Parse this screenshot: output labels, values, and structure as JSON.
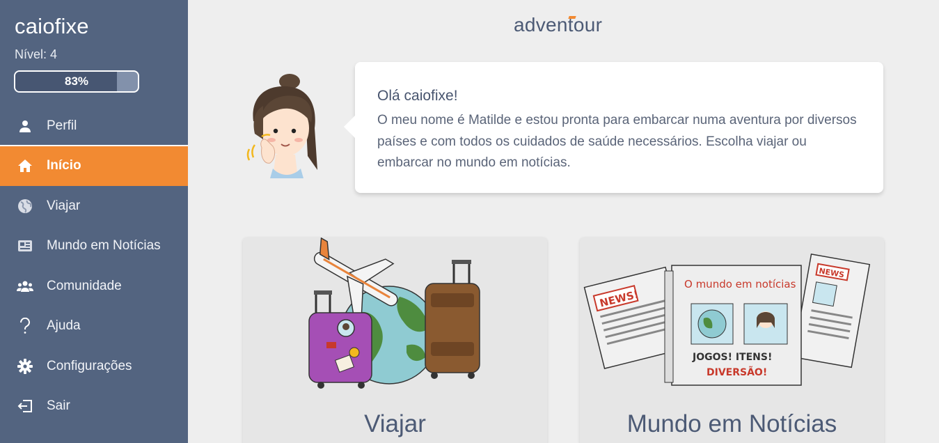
{
  "user": {
    "name": "caiofixe",
    "level_label": "Nível: 4",
    "progress_percent": 83,
    "progress_label": "83%"
  },
  "nav": [
    {
      "label": "Perfil",
      "icon": "person-icon",
      "active": false
    },
    {
      "label": "Início",
      "icon": "home-icon",
      "active": true
    },
    {
      "label": "Viajar",
      "icon": "globe-icon",
      "active": false
    },
    {
      "label": "Mundo em Notícias",
      "icon": "newspaper-icon",
      "active": false
    },
    {
      "label": "Comunidade",
      "icon": "community-icon",
      "active": false
    },
    {
      "label": "Ajuda",
      "icon": "question-icon",
      "active": false
    },
    {
      "label": "Configurações",
      "icon": "gear-icon",
      "active": false
    },
    {
      "label": "Sair",
      "icon": "logout-icon",
      "active": false
    }
  ],
  "brand": {
    "part1": "adven",
    "part2": "t",
    "part3": "our"
  },
  "bubble": {
    "greeting": "Olá caiofixe!",
    "text": "O meu nome é Matilde e estou pronta para embarcar numa aventura por diversos países e com todos os cuidados de saúde necessários. Escolha viajar ou embarcar no mundo em notícias."
  },
  "cards": {
    "travel_title": "Viajar",
    "news_title": "Mundo em Notícias"
  },
  "news_art": {
    "header": "O mundo em notícias",
    "headline1": "JOGOS! ITENS!",
    "headline2": "DIVERSÃO!",
    "news_tag": "NEWS!",
    "news_tag2": "NEWS"
  },
  "colors": {
    "sidebar": "#536480",
    "active": "#f28a32",
    "background": "#eeeeee",
    "text_dark": "#4c5a75"
  }
}
